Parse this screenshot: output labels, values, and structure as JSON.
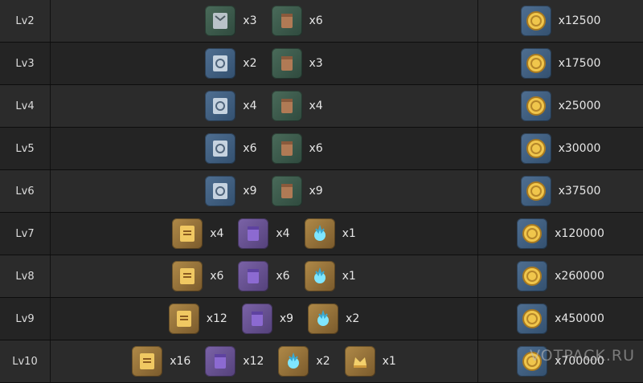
{
  "watermark": "VOTPACK.RU",
  "rows": [
    {
      "level": "Lv2",
      "materials": [
        {
          "icon": "teachings-book-icon",
          "rarity": "green",
          "qty": "x3"
        },
        {
          "icon": "common-scroll-icon",
          "rarity": "green",
          "qty": "x6"
        }
      ],
      "mora": "x12500"
    },
    {
      "level": "Lv3",
      "materials": [
        {
          "icon": "guide-book-icon",
          "rarity": "blue",
          "qty": "x2"
        },
        {
          "icon": "common-scroll-icon",
          "rarity": "green",
          "qty": "x3"
        }
      ],
      "mora": "x17500"
    },
    {
      "level": "Lv4",
      "materials": [
        {
          "icon": "guide-book-icon",
          "rarity": "blue",
          "qty": "x4"
        },
        {
          "icon": "common-scroll-icon",
          "rarity": "green",
          "qty": "x4"
        }
      ],
      "mora": "x25000"
    },
    {
      "level": "Lv5",
      "materials": [
        {
          "icon": "guide-book-icon",
          "rarity": "blue",
          "qty": "x6"
        },
        {
          "icon": "common-scroll-icon",
          "rarity": "green",
          "qty": "x6"
        }
      ],
      "mora": "x30000"
    },
    {
      "level": "Lv6",
      "materials": [
        {
          "icon": "guide-book-icon",
          "rarity": "blue",
          "qty": "x9"
        },
        {
          "icon": "common-scroll-icon",
          "rarity": "green",
          "qty": "x9"
        }
      ],
      "mora": "x37500"
    },
    {
      "level": "Lv7",
      "materials": [
        {
          "icon": "philosophies-book-icon",
          "rarity": "gold",
          "qty": "x4"
        },
        {
          "icon": "rare-scroll-icon",
          "rarity": "purple",
          "qty": "x4"
        },
        {
          "icon": "boss-drop-icon",
          "rarity": "gold",
          "qty": "x1"
        }
      ],
      "mora": "x120000"
    },
    {
      "level": "Lv8",
      "materials": [
        {
          "icon": "philosophies-book-icon",
          "rarity": "gold",
          "qty": "x6"
        },
        {
          "icon": "rare-scroll-icon",
          "rarity": "purple",
          "qty": "x6"
        },
        {
          "icon": "boss-drop-icon",
          "rarity": "gold",
          "qty": "x1"
        }
      ],
      "mora": "x260000"
    },
    {
      "level": "Lv9",
      "materials": [
        {
          "icon": "philosophies-book-icon",
          "rarity": "gold",
          "qty": "x12"
        },
        {
          "icon": "rare-scroll-icon",
          "rarity": "purple",
          "qty": "x9"
        },
        {
          "icon": "boss-drop-icon",
          "rarity": "gold",
          "qty": "x2"
        }
      ],
      "mora": "x450000"
    },
    {
      "level": "Lv10",
      "materials": [
        {
          "icon": "philosophies-book-icon",
          "rarity": "gold",
          "qty": "x16"
        },
        {
          "icon": "rare-scroll-icon",
          "rarity": "purple",
          "qty": "x12"
        },
        {
          "icon": "boss-drop-icon",
          "rarity": "gold",
          "qty": "x2"
        },
        {
          "icon": "crown-icon",
          "rarity": "gold",
          "qty": "x1"
        }
      ],
      "mora": "x700000"
    }
  ]
}
